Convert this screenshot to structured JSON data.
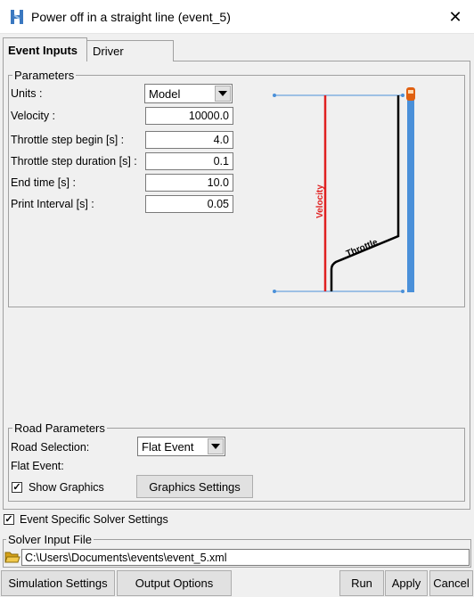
{
  "window": {
    "title": "Power off in a straight line (event_5)",
    "close_glyph": "✕"
  },
  "tabs": [
    {
      "label": "Event Inputs"
    },
    {
      "label": "Driver"
    }
  ],
  "parameters": {
    "title": "Parameters",
    "units": {
      "label": "Units :",
      "value": "Model"
    },
    "fields": [
      {
        "label": "Velocity :",
        "value": "10000.0"
      },
      {
        "label": "Throttle step begin [s] :",
        "value": "4.0"
      },
      {
        "label": "Throttle step duration [s] :",
        "value": "0.1"
      },
      {
        "label": "End time [s] :",
        "value": "10.0"
      },
      {
        "label": "Print Interval [s] :",
        "value": "0.05"
      }
    ]
  },
  "diagram": {
    "velocity_label": "Velocity",
    "throttle_label": "Throttle",
    "colors": {
      "velocity": "#e02020",
      "throttle": "#000000",
      "road": "#4a90d9",
      "guide": "#4a90d9",
      "car": "#e06010"
    }
  },
  "road": {
    "title": "Road Parameters",
    "selection_label": "Road Selection:",
    "selection_value": "Flat Event",
    "flat_event_label": "Flat Event:",
    "show_graphics_label": "Show Graphics",
    "show_graphics_checked": "✓",
    "graphics_settings_button": "Graphics Settings"
  },
  "solver": {
    "event_specific_label": "Event Specific Solver Settings",
    "event_specific_checked": "✓",
    "input_file_title": "Solver Input File",
    "input_file_path": "C:\\Users\\Documents\\events\\event_5.xml"
  },
  "buttons": {
    "simulation_settings": "Simulation Settings",
    "output_options": "Output Options",
    "run": "Run",
    "apply": "Apply",
    "cancel": "Cancel"
  }
}
